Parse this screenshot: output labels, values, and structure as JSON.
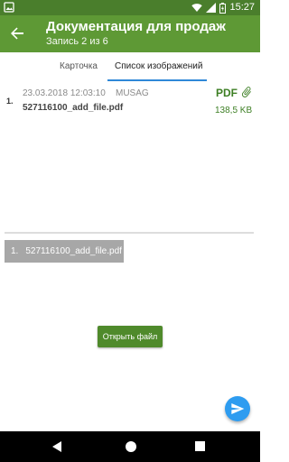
{
  "status": {
    "time": "15:27",
    "icons": [
      "wifi-icon",
      "signal-icon",
      "battery-icon"
    ]
  },
  "appbar": {
    "title": "Документация для продаж",
    "subtitle": "Запись 2 из 6"
  },
  "tabs": [
    {
      "label": "Карточка",
      "active": false
    },
    {
      "label": "Список изображений",
      "active": true
    }
  ],
  "attachment": {
    "number": "1.",
    "date": "23.03.2018 12:03:10",
    "user": "MUSAG",
    "filename": "527116100_add_file.pdf",
    "type": "PDF",
    "size": "138,5 KB"
  },
  "selected_file": {
    "number": "1.",
    "filename": "527116100_add_file.pdf"
  },
  "open_button": {
    "label": "Открыть файл"
  },
  "colors": {
    "appbar": "#5e9935",
    "statusbar": "#4a7e2c",
    "accent": "#2f88d8",
    "button": "#4f8a2b",
    "fab": "#2e9cf0"
  }
}
